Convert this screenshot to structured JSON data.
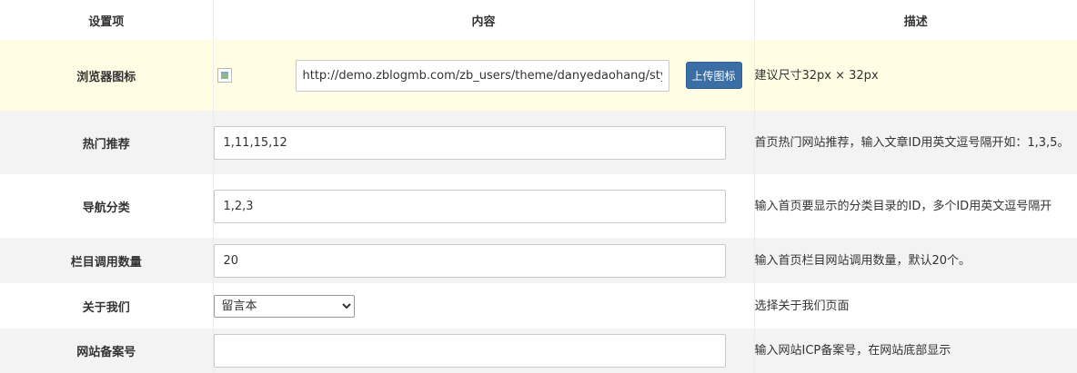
{
  "header": {
    "col_setting": "设置项",
    "col_content": "内容",
    "col_desc": "描述"
  },
  "rows": {
    "favicon": {
      "label": "浏览器图标",
      "image_alt": "",
      "value": "http://demo.zblogmb.com/zb_users/theme/danyedaohang/style/i",
      "button": "上传图标",
      "desc": "建议尺寸32px × 32px"
    },
    "hot": {
      "label": "热门推荐",
      "value": "1,11,15,12",
      "desc": "首页热门网站推荐，输入文章ID用英文逗号隔开如：1,3,5。"
    },
    "nav": {
      "label": "导航分类",
      "value": "1,2,3",
      "desc": "输入首页要显示的分类目录的ID，多个ID用英文逗号隔开"
    },
    "count": {
      "label": "栏目调用数量",
      "value": "20",
      "desc": "输入首页栏目网站调用数量，默认20个。"
    },
    "about": {
      "label": "关于我们",
      "selected": "留言本",
      "desc": "选择关于我们页面"
    },
    "icp": {
      "label": "网站备案号",
      "value": "",
      "desc": "输入网站ICP备案号，在网站底部显示"
    }
  },
  "colors": {
    "highlight_row": "#fffde3",
    "gray_row": "#f3f3f3",
    "button_bg": "#3a6ea5"
  }
}
